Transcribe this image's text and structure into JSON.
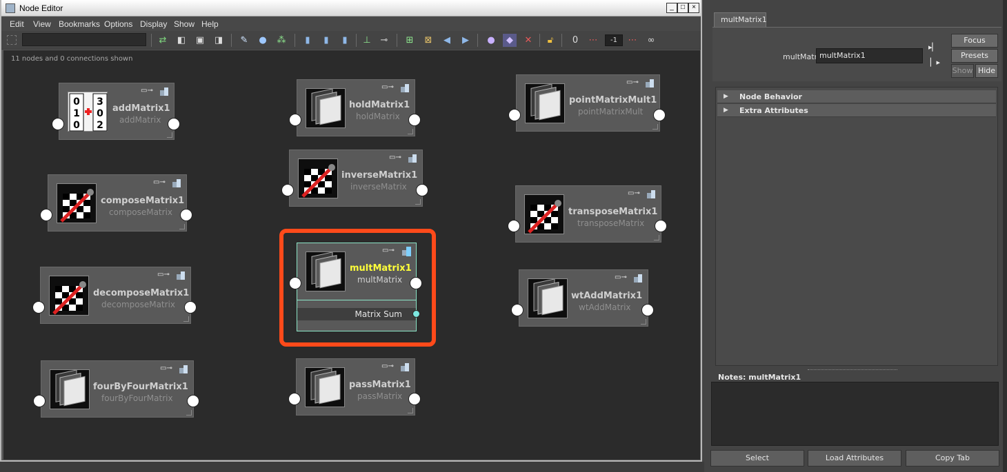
{
  "window": {
    "title": "Node Editor",
    "minimize": "_",
    "maximize": "□",
    "close": "×"
  },
  "menu": [
    "Edit",
    "View",
    "Bookmarks",
    "Options",
    "Display",
    "Show",
    "Help"
  ],
  "toolbar": {
    "zoom_value": "-1",
    "icons": [
      "swap-arrows-icon",
      "input-connections-icon",
      "in-out-connections-icon",
      "output-connections-icon",
      "clear-graph-icon",
      "graph-materials-icon",
      "layout-icon",
      "simple-mode-icon",
      "connected-mode-icon",
      "full-mode-icon",
      "pin-selected-icon",
      "unpin-icon",
      "create-bookmark-icon",
      "bookmark-icon",
      "previous-bookmark-icon",
      "next-bookmark-icon",
      "shading-icon",
      "swatch-icon",
      "hide-icon",
      "lock-icon",
      "zero-icon",
      "ellipsis-icon",
      "zoom-field",
      "dots-icon",
      "infinity-icon"
    ]
  },
  "graph": {
    "status": "11 nodes and 0 connections shown"
  },
  "nodes": [
    {
      "name": "addMatrix1",
      "type": "addMatrix"
    },
    {
      "name": "holdMatrix1",
      "type": "holdMatrix"
    },
    {
      "name": "pointMatrixMult1",
      "type": "pointMatrixMult"
    },
    {
      "name": "inverseMatrix1",
      "type": "inverseMatrix"
    },
    {
      "name": "composeMatrix1",
      "type": "composeMatrix"
    },
    {
      "name": "transposeMatrix1",
      "type": "transposeMatrix"
    },
    {
      "name": "multMatrix1",
      "type": "multMatrix",
      "attribute": "Matrix Sum"
    },
    {
      "name": "decomposeMatrix1",
      "type": "decomposeMatrix"
    },
    {
      "name": "wtAddMatrix1",
      "type": "wtAddMatrix"
    },
    {
      "name": "fourByFourMatrix1",
      "type": "fourByFourMatrix"
    },
    {
      "name": "passMatrix1",
      "type": "passMatrix"
    }
  ],
  "add_matrix_digits": [
    "0",
    "1",
    "0",
    "3",
    "0",
    "2"
  ],
  "side": {
    "tab": "multMatrix1",
    "node_label": "multMatrix:",
    "node_value": "multMatrix1",
    "focus": "Focus",
    "presets": "Presets",
    "show": "Show",
    "hide": "Hide",
    "sections": [
      "Node Behavior",
      "Extra Attributes"
    ],
    "notes_label": "Notes:  multMatrix1",
    "buttons": [
      "Select",
      "Load Attributes",
      "Copy Tab"
    ]
  },
  "colors": {
    "highlight": "#ff4a1a",
    "selected_name": "#ffff3a",
    "selected_border": "#8ce6c8",
    "port_attr": "#7de8e0"
  }
}
